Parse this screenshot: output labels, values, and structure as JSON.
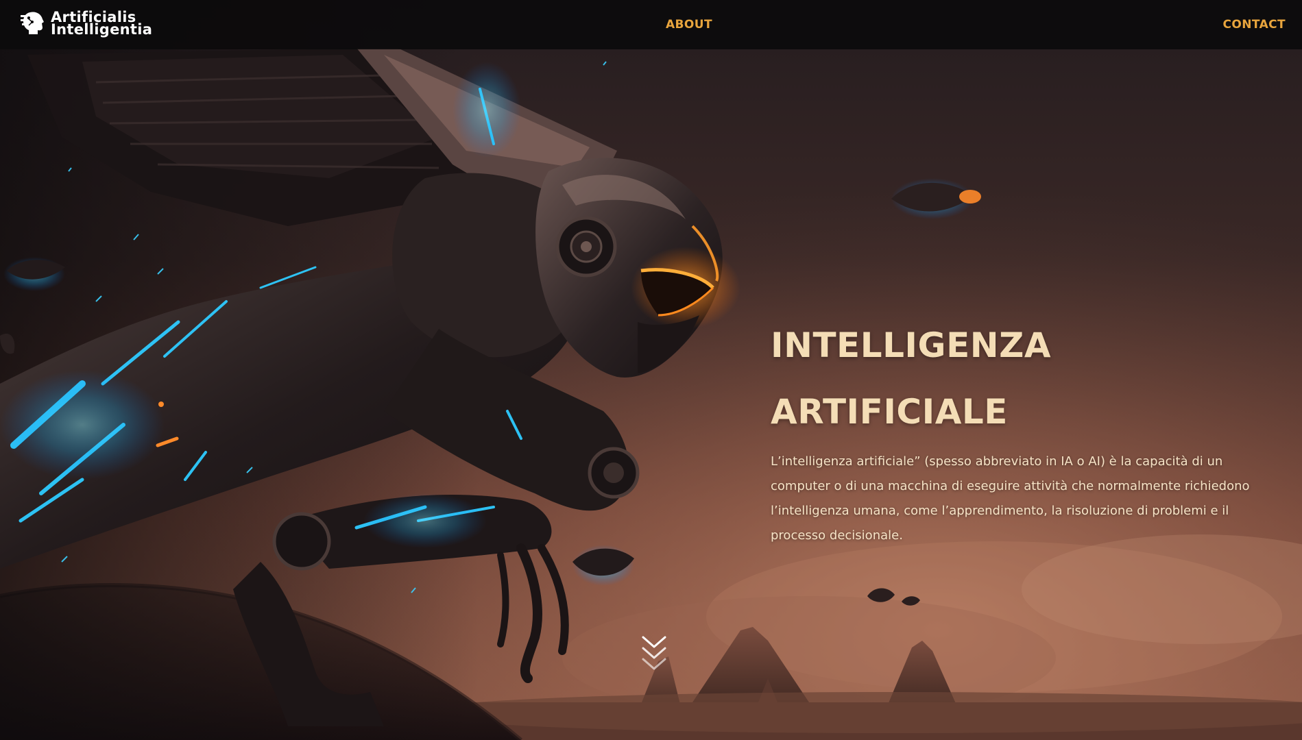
{
  "brand": {
    "name_line1": "Artificialis",
    "name_line2": "Intelligentia",
    "logo_icon": "robot-head-icon"
  },
  "nav": {
    "about": "ABOUT",
    "contact": "CONTACT"
  },
  "hero": {
    "title_line1": "INTELLIGENZA",
    "title_line2": "ARTIFICIALE",
    "description": "L’intelligenza artificiale” (spesso abbreviato in IA o AI) è la capacità di un computer o di una macchina di eseguire attività che normalmente richiedono l’intelligenza umana, come l’apprendimento, la risoluzione di problemi e il processo decisionale.",
    "scroll_icon": "chevrons-down-icon"
  },
  "colors": {
    "accent": "#e8a53d",
    "title": "#f4ddb6",
    "text": "#f6e3c6",
    "navbar": "#0c0b0c",
    "glow": "#29c8ff"
  }
}
